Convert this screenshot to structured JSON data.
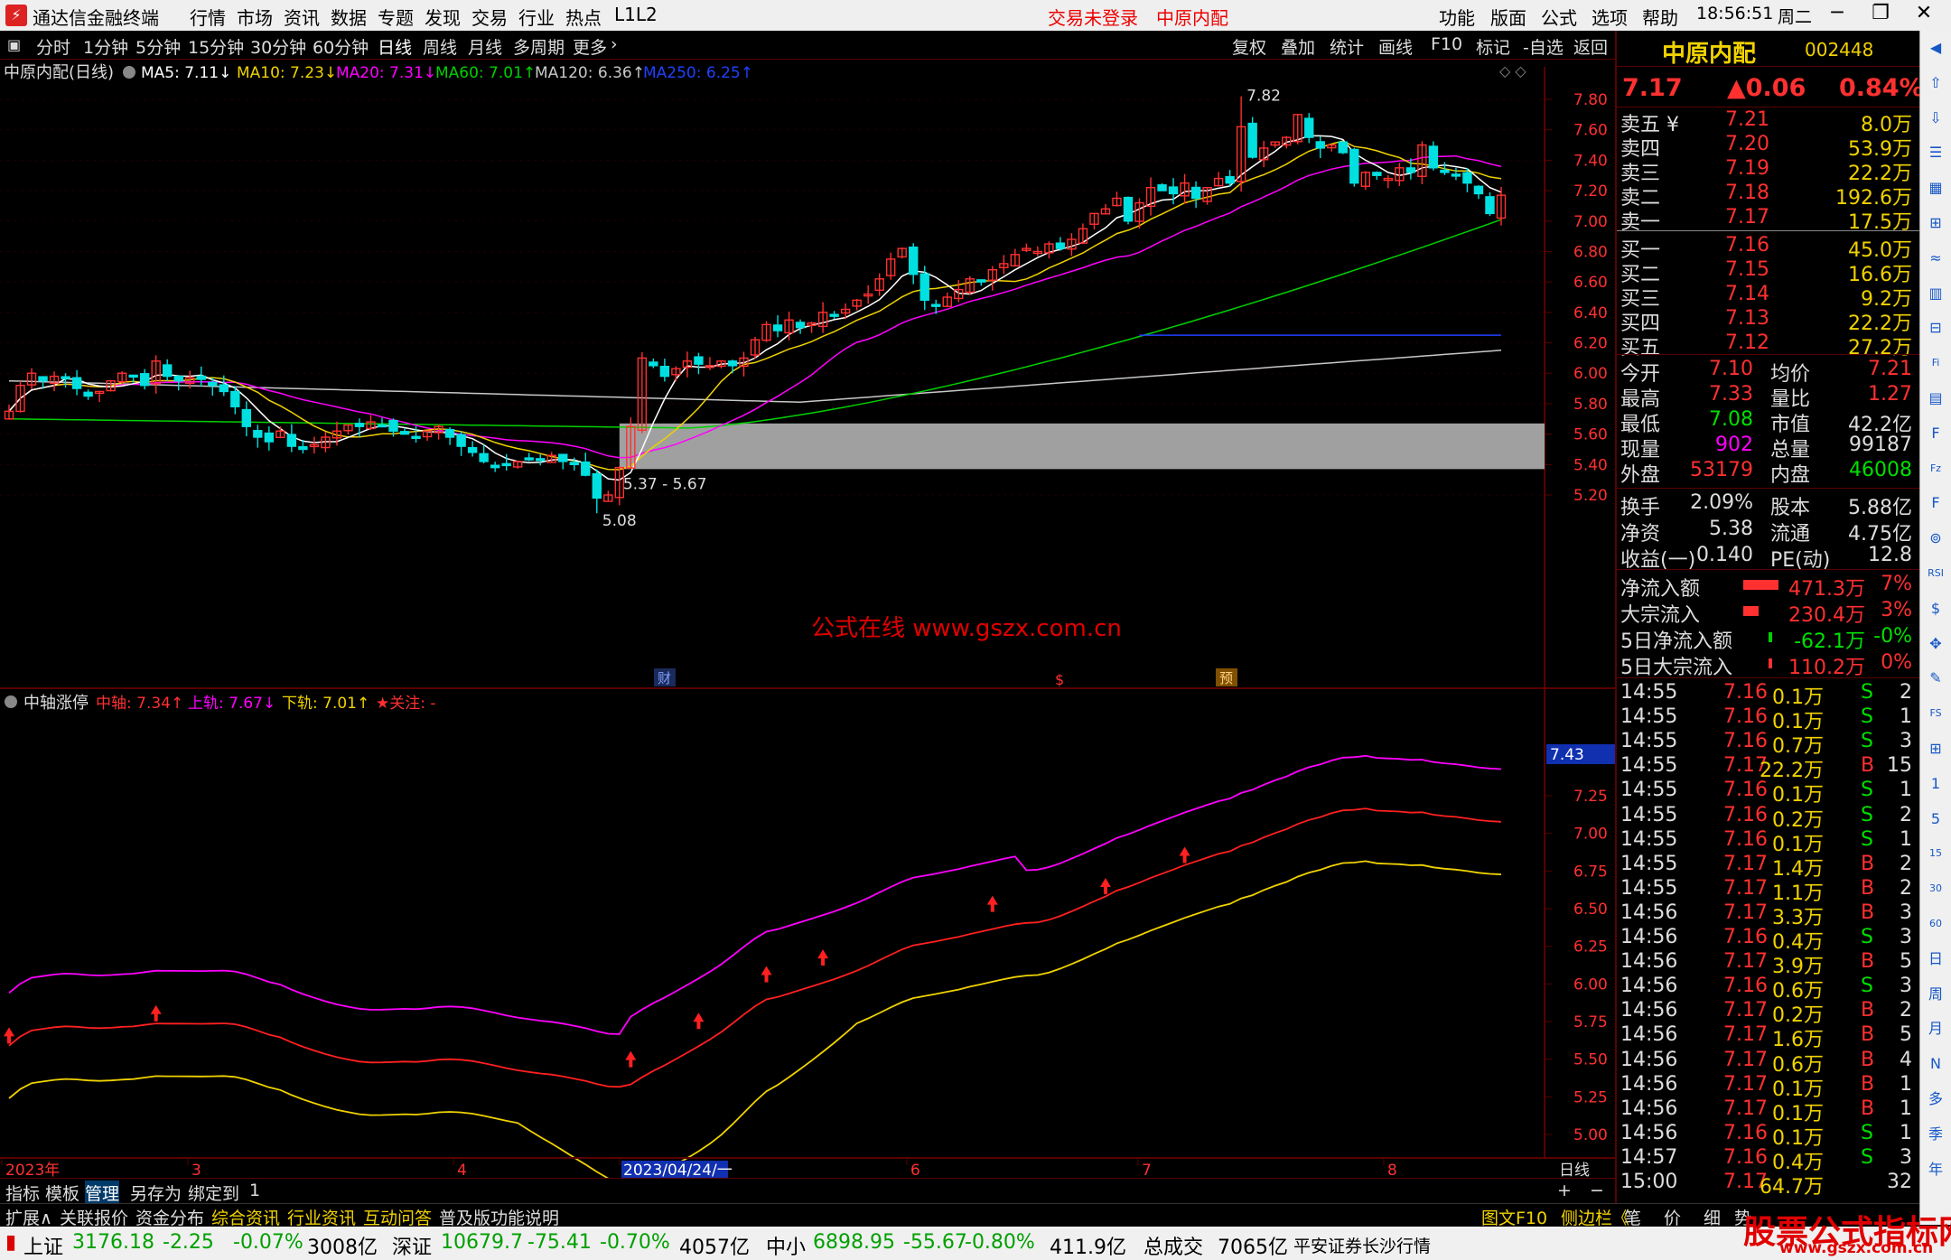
{
  "titlebar": {
    "app_name": "通达信金融终端",
    "menus": [
      "行情",
      "市场",
      "资讯",
      "数据",
      "专题",
      "发现",
      "交易",
      "行业",
      "热点",
      "L1L2"
    ],
    "trade_status": "交易未登录",
    "stock_name": "中原内配",
    "right_menus": [
      "功能",
      "版面",
      "公式",
      "选项",
      "帮助"
    ],
    "time": "18:56:51",
    "weekday": "周二"
  },
  "toolbar": {
    "periods": [
      "分时",
      "1分钟",
      "5分钟",
      "15分钟",
      "30分钟",
      "60分钟",
      "日线",
      "周线",
      "月线",
      "多周期",
      "更多"
    ],
    "active_period": "日线",
    "right_buttons": [
      "复权",
      "叠加",
      "统计",
      "画线",
      "F10",
      "标记",
      "-自选",
      "返回"
    ]
  },
  "main_chart": {
    "header": "中原内配(日线)",
    "ma_labels": [
      {
        "text": "MA5: 7.11↓",
        "color": "#ffffff"
      },
      {
        "text": "MA10: 7.23↓",
        "color": "#f0d200"
      },
      {
        "text": "MA20: 7.31↓",
        "color": "#ff00ff"
      },
      {
        "text": "MA60: 7.01↑",
        "color": "#00d000"
      },
      {
        "text": "MA120: 6.36↑",
        "color": "#c8c8c8"
      },
      {
        "text": "MA250: 6.25↑",
        "color": "#2040ff"
      }
    ],
    "y_ticks": [
      "7.80",
      "7.60",
      "7.40",
      "7.20",
      "7.00",
      "6.80",
      "6.60",
      "6.40",
      "6.20",
      "6.00",
      "5.80",
      "5.60",
      "5.40",
      "5.20"
    ],
    "high_label": "7.82",
    "low_label": "5.08",
    "gap_label": "5.37 - 5.67",
    "watermark": "公式在线  www.gszx.com.cn",
    "event_markers": [
      "财",
      "$",
      "预"
    ]
  },
  "indicator_chart": {
    "name": "中轴涨停",
    "labels": [
      {
        "text": "中轴: 7.34↑",
        "color": "#ff3030"
      },
      {
        "text": "上轨: 7.67↓",
        "color": "#ff00ff"
      },
      {
        "text": "下轨: 7.01↑",
        "color": "#f0d200"
      },
      {
        "text": "★关注: -",
        "color": "#ff3030"
      }
    ],
    "y_ticks": [
      "7.25",
      "7.00",
      "6.75",
      "6.50",
      "6.25",
      "6.00",
      "5.75",
      "5.50",
      "5.25",
      "5.00"
    ],
    "current_value": "7.43"
  },
  "x_axis": {
    "labels": [
      "2023年",
      "3",
      "4",
      "2023/04/24/一",
      "6",
      "7",
      "8"
    ],
    "period": "日线"
  },
  "chart_data": {
    "type": "candlestick",
    "title": "中原内配(日线)",
    "ylim": [
      5.0,
      7.9
    ],
    "high": 7.82,
    "low": 5.08,
    "last_close": 7.17,
    "gap_range": [
      5.37,
      5.67
    ],
    "ma_values": {
      "MA5": 7.11,
      "MA10": 7.23,
      "MA20": 7.31,
      "MA60": 7.01,
      "MA120": 6.36,
      "MA250": 6.25
    },
    "close": [
      5.75,
      5.92,
      6.0,
      5.95,
      5.98,
      5.97,
      5.9,
      5.85,
      5.88,
      5.95,
      6.0,
      5.98,
      5.92,
      6.08,
      5.98,
      5.95,
      5.97,
      5.96,
      5.92,
      5.88,
      5.78,
      5.65,
      5.58,
      5.55,
      5.62,
      5.52,
      5.5,
      5.53,
      5.58,
      5.62,
      5.66,
      5.65,
      5.68,
      5.66,
      5.62,
      5.6,
      5.58,
      5.62,
      5.65,
      5.58,
      5.52,
      5.48,
      5.42,
      5.38,
      5.4,
      5.42,
      5.44,
      5.43,
      5.46,
      5.42,
      5.4,
      5.33,
      5.18,
      5.2,
      5.38,
      5.65,
      6.1,
      6.05,
      5.98,
      6.03,
      6.08,
      6.06,
      6.05,
      6.08,
      6.05,
      6.1,
      6.22,
      6.32,
      6.28,
      6.35,
      6.3,
      6.33,
      6.4,
      6.38,
      6.42,
      6.48,
      6.52,
      6.62,
      6.75,
      6.82,
      6.65,
      6.48,
      6.45,
      6.5,
      6.55,
      6.62,
      6.6,
      6.68,
      6.72,
      6.78,
      6.82,
      6.8,
      6.85,
      6.82,
      6.88,
      6.95,
      7.05,
      7.08,
      7.15,
      7.0,
      7.12,
      7.22,
      7.2,
      7.18,
      7.25,
      7.15,
      7.22,
      7.28,
      7.25,
      7.62,
      7.42,
      7.48,
      7.52,
      7.55,
      7.7,
      7.55,
      7.48,
      7.5,
      7.45,
      7.25,
      7.32,
      7.3,
      7.28,
      7.35,
      7.32,
      7.5,
      7.35,
      7.32,
      7.3,
      7.25,
      7.18,
      7.05,
      7.17
    ]
  },
  "right_panel": {
    "stock_name": "中原内配",
    "stock_code": "002448",
    "price": "7.17",
    "change": "▲0.06",
    "change_pct": "0.84%",
    "asks": [
      {
        "label": "卖五 ¥",
        "price": "7.21",
        "vol": "8.0万"
      },
      {
        "label": "卖四",
        "price": "7.20",
        "vol": "53.9万"
      },
      {
        "label": "卖三",
        "price": "7.19",
        "vol": "22.2万"
      },
      {
        "label": "卖二",
        "price": "7.18",
        "vol": "192.6万"
      },
      {
        "label": "卖一",
        "price": "7.17",
        "vol": "17.5万"
      }
    ],
    "bids": [
      {
        "label": "买一",
        "price": "7.16",
        "vol": "45.0万"
      },
      {
        "label": "买二",
        "price": "7.15",
        "vol": "16.6万"
      },
      {
        "label": "买三",
        "price": "7.14",
        "vol": "9.2万"
      },
      {
        "label": "买四",
        "price": "7.13",
        "vol": "22.2万"
      },
      {
        "label": "买五",
        "price": "7.12",
        "vol": "27.2万"
      }
    ],
    "stats": [
      {
        "l1": "今开",
        "v1": "7.10",
        "c1": "red",
        "l2": "均价",
        "v2": "7.21",
        "c2": "red"
      },
      {
        "l1": "最高",
        "v1": "7.33",
        "c1": "red",
        "l2": "量比",
        "v2": "1.27",
        "c2": "red"
      },
      {
        "l1": "最低",
        "v1": "7.08",
        "c1": "grn",
        "l2": "市值",
        "v2": "42.2亿",
        "c2": "wht"
      },
      {
        "l1": "现量",
        "v1": "902",
        "c1": "mag",
        "l2": "总量",
        "v2": "99187",
        "c2": "wht"
      },
      {
        "l1": "外盘",
        "v1": "53179",
        "c1": "red",
        "l2": "内盘",
        "v2": "46008",
        "c2": "grn"
      }
    ],
    "stats2": [
      {
        "l1": "换手",
        "v1": "2.09%",
        "l2": "股本",
        "v2": "5.88亿"
      },
      {
        "l1": "净资",
        "v1": "5.38",
        "l2": "流通",
        "v2": "4.75亿"
      },
      {
        "l1": "收益(一)",
        "v1": "0.140",
        "l2": "PE(动)",
        "v2": "12.8"
      }
    ],
    "flows": [
      {
        "label": "净流入额",
        "value": "471.3万",
        "pct": "7%",
        "color": "red",
        "bar": 0.7
      },
      {
        "label": "大宗流入",
        "value": "230.4万",
        "pct": "3%",
        "color": "red",
        "bar": 0.3
      },
      {
        "label": "5日净流入额",
        "value": "-62.1万",
        "pct": "-0%",
        "color": "grn",
        "bar": 0.05
      },
      {
        "label": "5日大宗流入",
        "value": "110.2万",
        "pct": "0%",
        "color": "red",
        "bar": 0.05
      }
    ],
    "ticks": [
      [
        "14:55",
        "7.16",
        "0.1万",
        "S",
        "2"
      ],
      [
        "14:55",
        "7.16",
        "0.1万",
        "S",
        "1"
      ],
      [
        "14:55",
        "7.16",
        "0.7万",
        "S",
        "3"
      ],
      [
        "14:55",
        "7.17",
        "22.2万",
        "B",
        "15"
      ],
      [
        "14:55",
        "7.16",
        "0.1万",
        "S",
        "1"
      ],
      [
        "14:55",
        "7.16",
        "0.2万",
        "S",
        "2"
      ],
      [
        "14:55",
        "7.16",
        "0.1万",
        "S",
        "1"
      ],
      [
        "14:55",
        "7.17",
        "1.4万",
        "B",
        "2"
      ],
      [
        "14:55",
        "7.17",
        "1.1万",
        "B",
        "2"
      ],
      [
        "14:56",
        "7.17",
        "3.3万",
        "B",
        "3"
      ],
      [
        "14:56",
        "7.16",
        "0.4万",
        "S",
        "3"
      ],
      [
        "14:56",
        "7.17",
        "3.9万",
        "B",
        "5"
      ],
      [
        "14:56",
        "7.16",
        "0.6万",
        "S",
        "3"
      ],
      [
        "14:56",
        "7.17",
        "0.2万",
        "B",
        "2"
      ],
      [
        "14:56",
        "7.17",
        "1.6万",
        "B",
        "5"
      ],
      [
        "14:56",
        "7.17",
        "0.6万",
        "B",
        "4"
      ],
      [
        "14:56",
        "7.17",
        "0.1万",
        "B",
        "1"
      ],
      [
        "14:56",
        "7.17",
        "0.1万",
        "B",
        "1"
      ],
      [
        "14:56",
        "7.16",
        "0.1万",
        "S",
        "1"
      ],
      [
        "14:57",
        "7.16",
        "0.4万",
        "S",
        "3"
      ],
      [
        "15:00",
        "7.17",
        "64.7万",
        "",
        "32"
      ]
    ]
  },
  "side_icons": [
    "◀",
    "⇧",
    "⇩",
    "☰",
    "▦",
    "⊞",
    "≈",
    "▥",
    "⊟",
    "Fi",
    "▤",
    "F",
    "Fz",
    "F",
    "⊚",
    "RSI",
    "$",
    "✥",
    "✎",
    "FS",
    "⊞",
    "1",
    "5",
    "15",
    "30",
    "60",
    "日",
    "周",
    "月",
    "N",
    "多",
    "季",
    "年"
  ],
  "bottom_tabs1": [
    "指标",
    "模板",
    "管理",
    "另存为",
    "绑定到",
    "1"
  ],
  "bottom_tabs2": [
    "扩展∧",
    "关联报价",
    "资金分布",
    "综合资讯",
    "行业资讯",
    "互动问答",
    "普及版功能说明"
  ],
  "bottom_right": [
    "图文F10",
    "侧边栏《",
    "笔",
    "价",
    "细",
    "势"
  ],
  "status_bar": {
    "sh_label": "上证",
    "sh_value": "3176.18",
    "sh_change": "-2.25",
    "sh_pct": "-0.07%",
    "sh_amount": "3008亿",
    "sz_label": "深证",
    "sz_value": "10679.7",
    "sz_change": "-75.41",
    "sz_pct": "-0.70%",
    "sz_amount": "4057亿",
    "zx_label": "中小",
    "zx_value": "6898.95",
    "zx_change": "-55.67",
    "zx_pct": "-0.80%",
    "zx_amount": "411.9亿",
    "total_label": "总成交",
    "total_value": "7065亿",
    "broker": "平安证券长沙行情"
  },
  "brand_watermark": {
    "title": "股票公式指标网",
    "url": "www.gszx.com.cn"
  },
  "colors": {
    "up": "#ff3030",
    "down": "#00e0e0",
    "ma5": "#ffffff",
    "ma10": "#f0d200",
    "ma20": "#ff00ff",
    "ma60": "#00d000",
    "ma120": "#c8c8c8",
    "ma250": "#2040ff",
    "grid": "#5a0000",
    "gap": "#a0a0a0"
  }
}
